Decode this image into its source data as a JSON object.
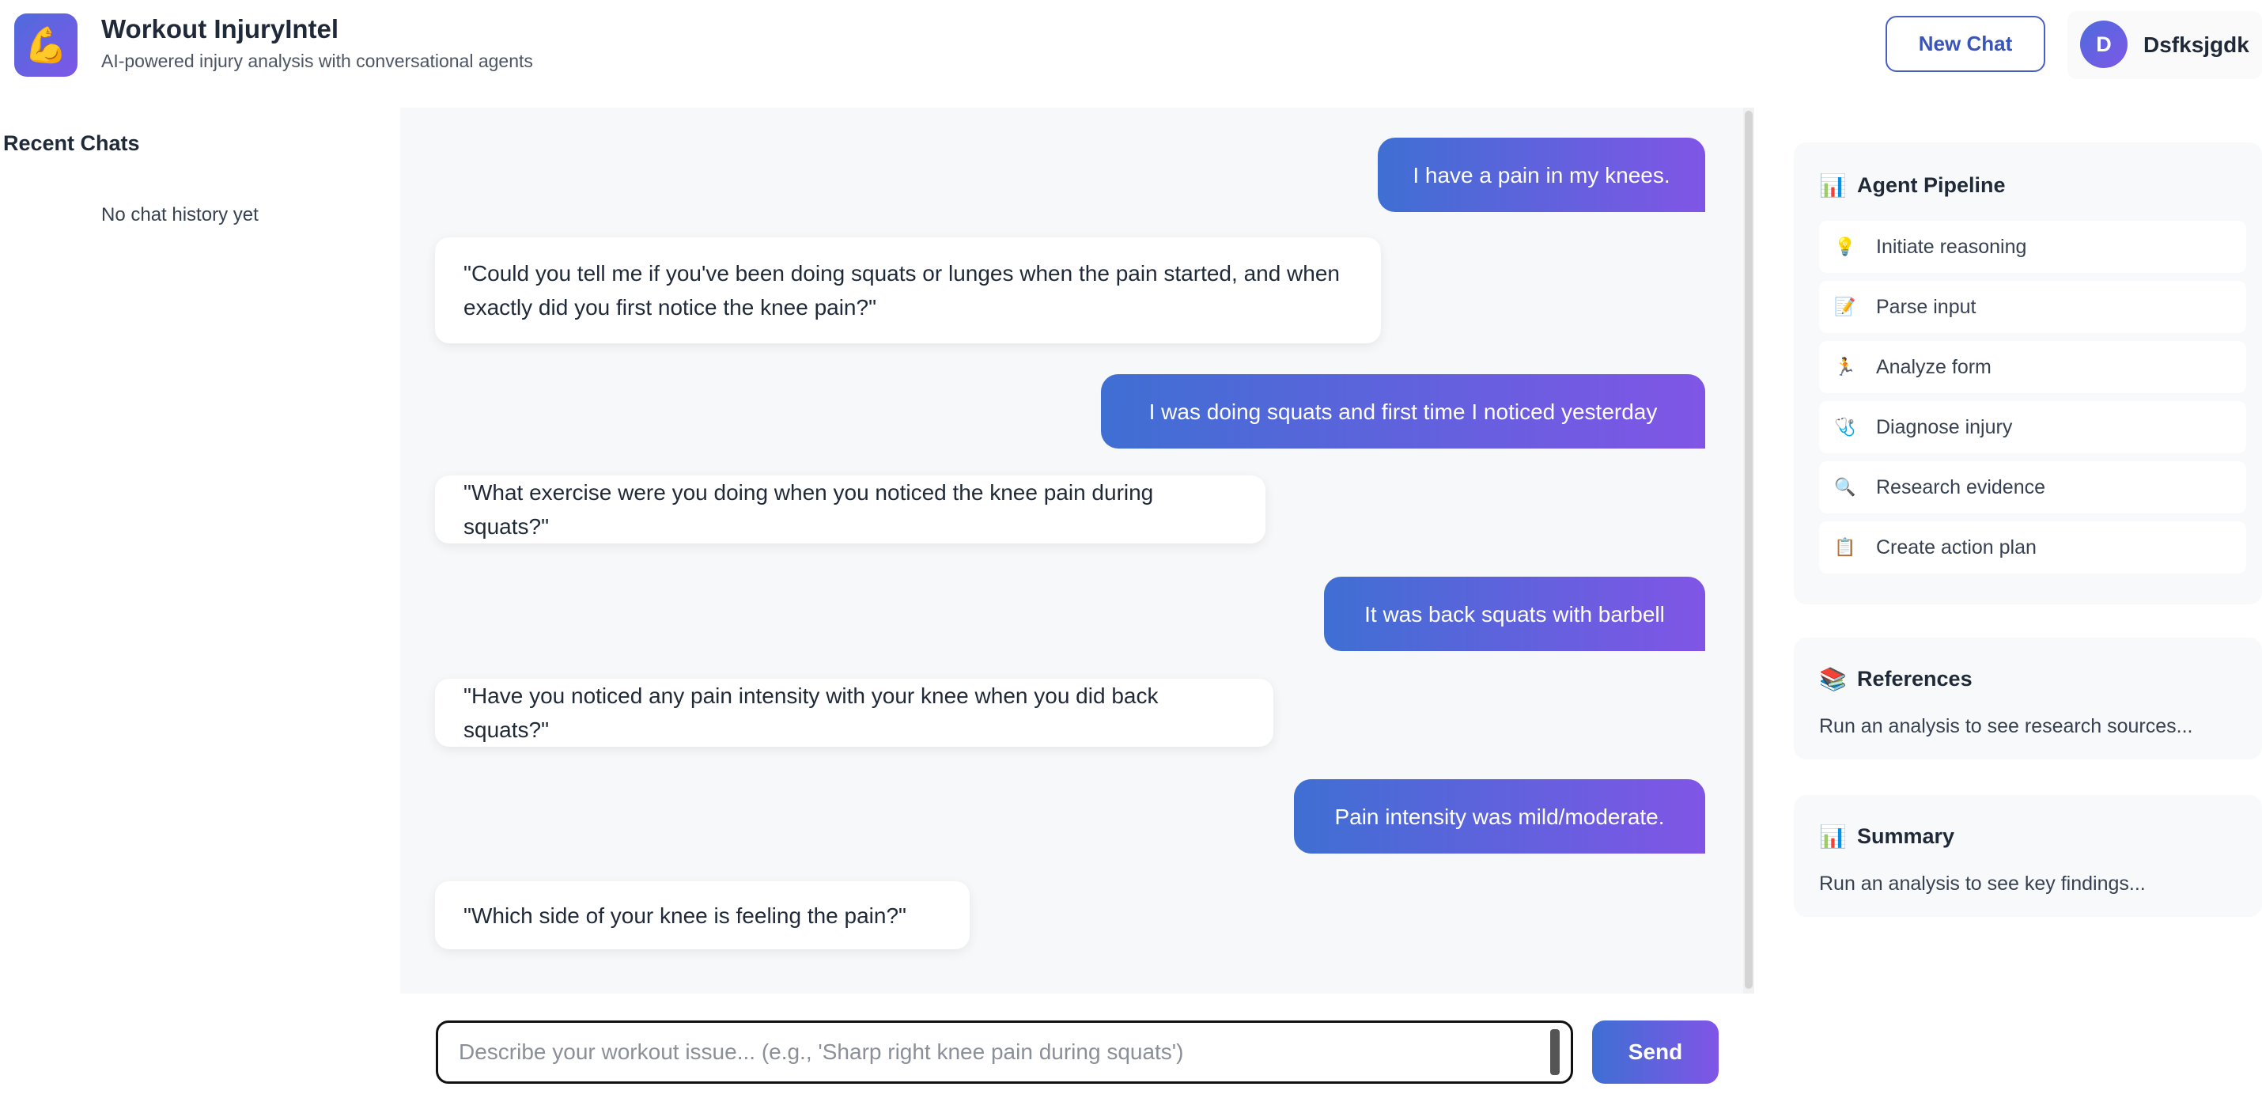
{
  "header": {
    "app_title": "Workout InjuryIntel",
    "app_subtitle": "AI-powered injury analysis with conversational agents",
    "new_chat_label": "New Chat",
    "user_initial": "D",
    "username": "Dsfksjgdk",
    "logo_icon": "💪"
  },
  "sidebar": {
    "title": "Recent Chats",
    "empty_text": "No chat history yet"
  },
  "chat": {
    "messages": [
      {
        "role": "user",
        "text": "I have a pain in my knees."
      },
      {
        "role": "bot",
        "text": "\"Could you tell me if you've been doing squats or lunges when the pain started, and when exactly did you first notice the knee pain?\""
      },
      {
        "role": "user",
        "text": "I was doing squats and first time I noticed yesterday"
      },
      {
        "role": "bot",
        "text": "\"What exercise were you doing when you noticed the knee pain during squats?\""
      },
      {
        "role": "user",
        "text": "It was back squats with barbell"
      },
      {
        "role": "bot",
        "text": "\"Have you noticed any pain intensity with your knee when you did back squats?\""
      },
      {
        "role": "user",
        "text": "Pain intensity was mild/moderate."
      },
      {
        "role": "bot",
        "text": "\"Which side of your knee is feeling the pain?\""
      }
    ]
  },
  "composer": {
    "placeholder": "Describe your workout issue... (e.g., 'Sharp right knee pain during squats')",
    "value": "",
    "send_label": "Send"
  },
  "pipeline": {
    "title": "Agent Pipeline",
    "title_icon": "📊",
    "steps": [
      {
        "icon": "💡",
        "label": "Initiate reasoning"
      },
      {
        "icon": "📝",
        "label": "Parse input"
      },
      {
        "icon": "🏃",
        "label": "Analyze form"
      },
      {
        "icon": "🩺",
        "label": "Diagnose injury"
      },
      {
        "icon": "🔍",
        "label": "Research evidence"
      },
      {
        "icon": "📋",
        "label": "Create action plan"
      }
    ]
  },
  "references": {
    "title": "References",
    "title_icon": "📚",
    "body": "Run an analysis to see research sources..."
  },
  "summary": {
    "title": "Summary",
    "title_icon": "📊",
    "body": "Run an analysis to see key findings..."
  }
}
